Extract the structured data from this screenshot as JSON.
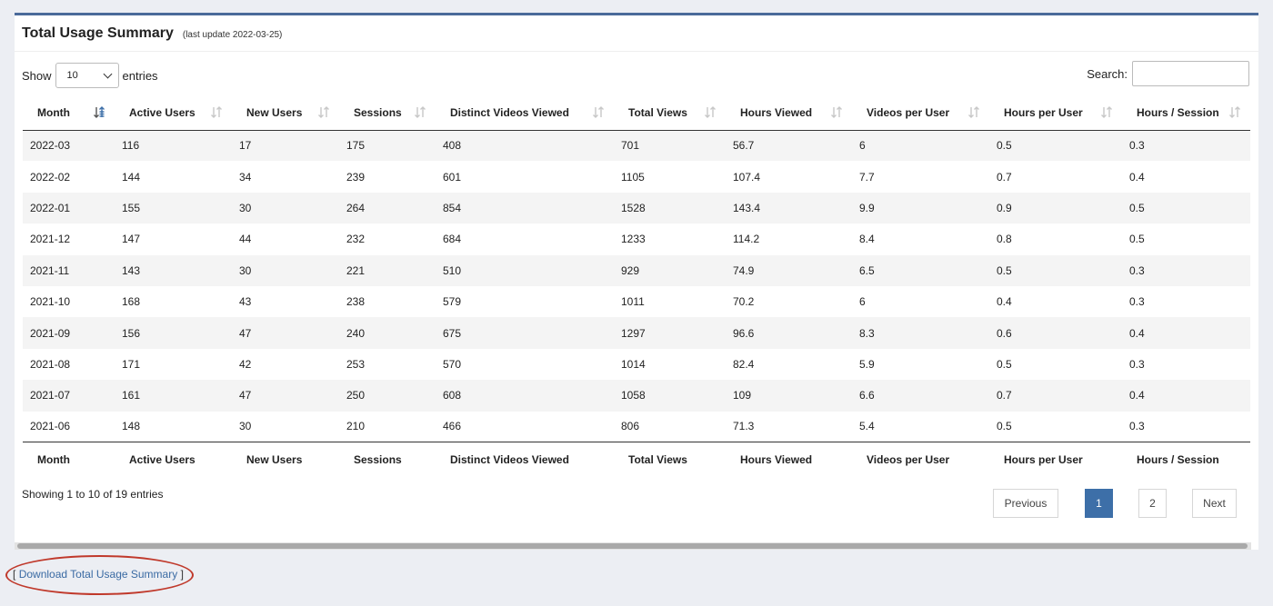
{
  "panel": {
    "title": "Total Usage Summary",
    "update_note": "(last update 2022-03-25)"
  },
  "controls": {
    "show_label": "Show",
    "show_value": "10",
    "entries_label": "entries",
    "search_label": "Search:",
    "search_value": ""
  },
  "table": {
    "columns": [
      "Month",
      "Active Users",
      "New Users",
      "Sessions",
      "Distinct Videos Viewed",
      "Total Views",
      "Hours Viewed",
      "Videos per User",
      "Hours per User",
      "Hours / Session"
    ],
    "rows": [
      [
        "2022-03",
        "116",
        "17",
        "175",
        "408",
        "701",
        "56.7",
        "6",
        "0.5",
        "0.3"
      ],
      [
        "2022-02",
        "144",
        "34",
        "239",
        "601",
        "1105",
        "107.4",
        "7.7",
        "0.7",
        "0.4"
      ],
      [
        "2022-01",
        "155",
        "30",
        "264",
        "854",
        "1528",
        "143.4",
        "9.9",
        "0.9",
        "0.5"
      ],
      [
        "2021-12",
        "147",
        "44",
        "232",
        "684",
        "1233",
        "114.2",
        "8.4",
        "0.8",
        "0.5"
      ],
      [
        "2021-11",
        "143",
        "30",
        "221",
        "510",
        "929",
        "74.9",
        "6.5",
        "0.5",
        "0.3"
      ],
      [
        "2021-10",
        "168",
        "43",
        "238",
        "579",
        "1011",
        "70.2",
        "6",
        "0.4",
        "0.3"
      ],
      [
        "2021-09",
        "156",
        "47",
        "240",
        "675",
        "1297",
        "96.6",
        "8.3",
        "0.6",
        "0.4"
      ],
      [
        "2021-08",
        "171",
        "42",
        "253",
        "570",
        "1014",
        "82.4",
        "5.9",
        "0.5",
        "0.3"
      ],
      [
        "2021-07",
        "161",
        "47",
        "250",
        "608",
        "1058",
        "109",
        "6.6",
        "0.7",
        "0.4"
      ],
      [
        "2021-06",
        "148",
        "30",
        "210",
        "466",
        "806",
        "71.3",
        "5.4",
        "0.5",
        "0.3"
      ]
    ],
    "sorted_column": "Month"
  },
  "footer": {
    "info": "Showing 1 to 10 of 19 entries",
    "pager": {
      "previous": "Previous",
      "pages": [
        "1",
        "2"
      ],
      "active_page": "1",
      "next": "Next"
    }
  },
  "download": {
    "open_bracket": "[",
    "link": "Download Total Usage Summary",
    "close_bracket": "]"
  },
  "colors": {
    "accent": "#3d6fa8",
    "annotation": "#c0392b"
  }
}
